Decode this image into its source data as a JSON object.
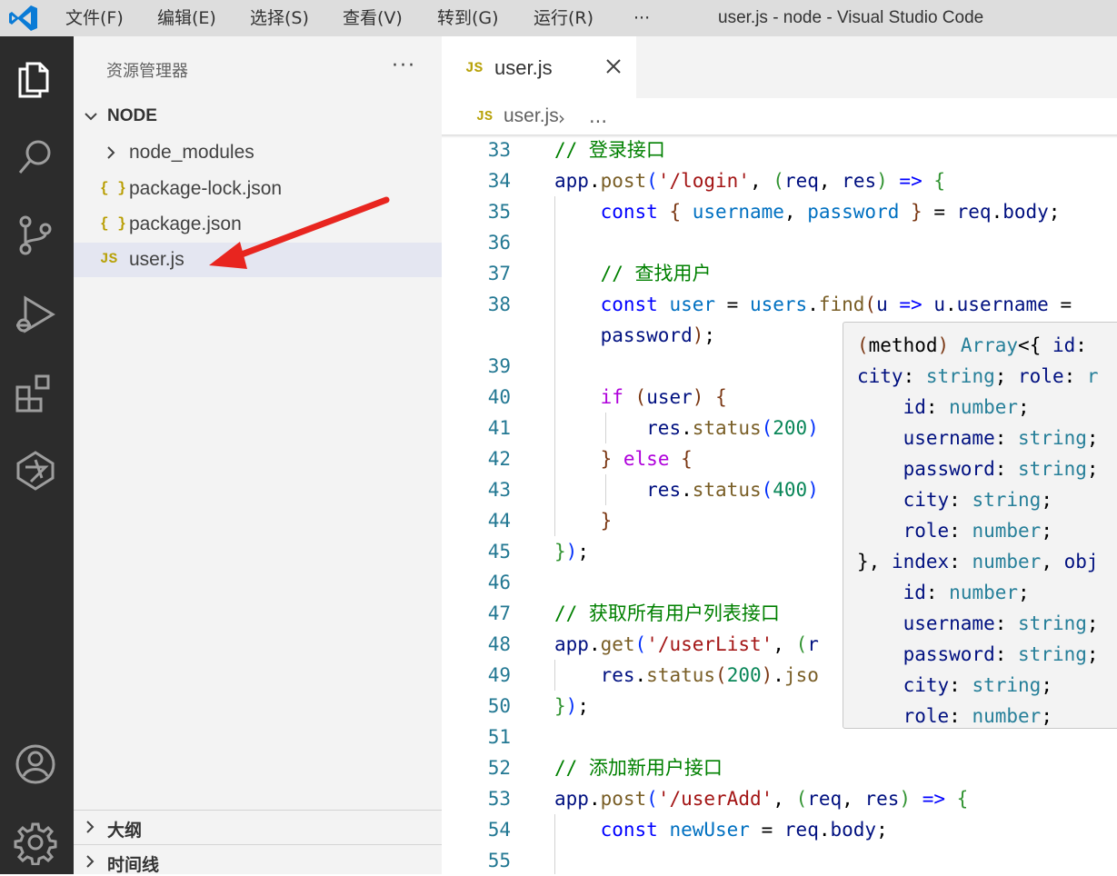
{
  "titlebar": {
    "menus": [
      "文件(F)",
      "编辑(E)",
      "选择(S)",
      "查看(V)",
      "转到(G)",
      "运行(R)",
      "···"
    ],
    "window_title": "user.js - node - Visual Studio Code"
  },
  "activity_bar": {
    "icons": [
      "files-icon",
      "search-icon",
      "source-control-icon",
      "run-debug-icon",
      "extensions-icon",
      "ai-assistant-icon",
      "account-icon",
      "settings-gear-icon"
    ]
  },
  "sidebar": {
    "title": "资源管理器",
    "more": "···",
    "folder": "NODE",
    "items": [
      {
        "label": "node_modules",
        "icon": "chevron-right-icon",
        "selected": false
      },
      {
        "label": "package-lock.json",
        "icon": "json-file-icon",
        "glyph": "{ }",
        "selected": false
      },
      {
        "label": "package.json",
        "icon": "json-file-icon",
        "glyph": "{ }",
        "selected": false
      },
      {
        "label": "user.js",
        "icon": "js-file-icon",
        "glyph": "JS",
        "selected": true
      }
    ],
    "panels": [
      "大纲",
      "时间线"
    ]
  },
  "tab": {
    "icon": "JS",
    "label": "user.js"
  },
  "breadcrumb": {
    "icon": "JS",
    "file": "user.js",
    "separator": "›",
    "more": "..."
  },
  "editor": {
    "line_numbers": [
      "33",
      "34",
      "35",
      "36",
      "37",
      "38",
      "",
      "39",
      "40",
      "41",
      "42",
      "43",
      "44",
      "45",
      "46",
      "47",
      "48",
      "49",
      "50",
      "51",
      "52",
      "53",
      "54",
      "55"
    ],
    "comments": {
      "login": "// 登录接口",
      "find_user": "// 查找用户",
      "get_list": "// 获取所有用户列表接口",
      "add_user": "// 添加新用户接口"
    }
  },
  "hover": {
    "lines": [
      "(method) Array<{ id: ",
      "city: string; role: r",
      "    id: number;",
      "    username: string;",
      "    password: string;",
      "    city: string;",
      "    role: number;",
      "}, index: number, obj",
      "    id: number;",
      "    username: string;",
      "    password: string;",
      "    city: string;",
      "    role: number;"
    ]
  },
  "colors": {
    "activity_bg": "#2c2c2c",
    "sidebar_bg": "#f3f3f3",
    "titlebar_bg": "#dddddd",
    "selection_bg": "#e4e6f1",
    "arrow": "#e8251f",
    "vscode_blue": "#0a7bd6"
  }
}
